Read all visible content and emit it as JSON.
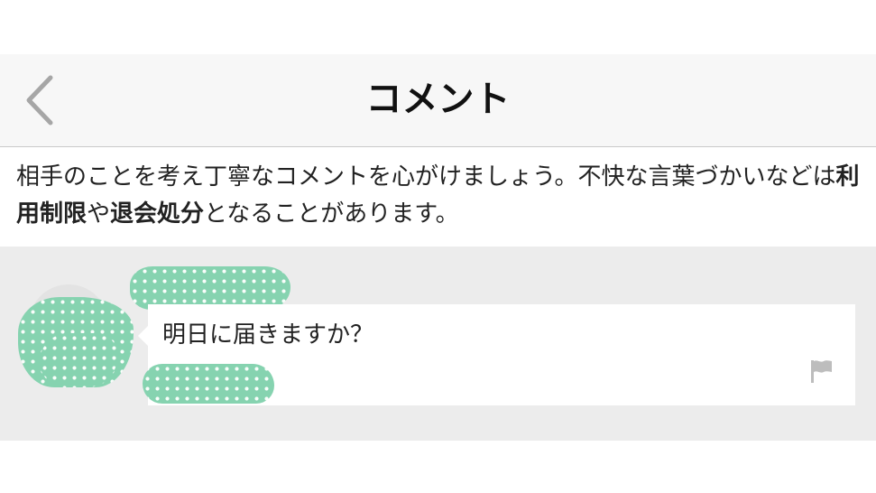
{
  "header": {
    "title": "コメント",
    "back_icon": "chevron-left-icon"
  },
  "notice": {
    "text_1": "相手のことを考え丁寧なコメントを心がけましょう。不快な言葉づかいなどは",
    "bold_1": "利用制限",
    "text_2": "や",
    "bold_2": "退会処分",
    "text_3": "となることがあります。"
  },
  "comments": [
    {
      "text": "明日に届きますか？",
      "flag_icon": "flag-icon"
    }
  ],
  "colors": {
    "header_bg": "#f7f7f7",
    "list_bg": "#ececec",
    "redaction_green": "#86d3b0",
    "icon_gray": "#bdbdbd"
  }
}
